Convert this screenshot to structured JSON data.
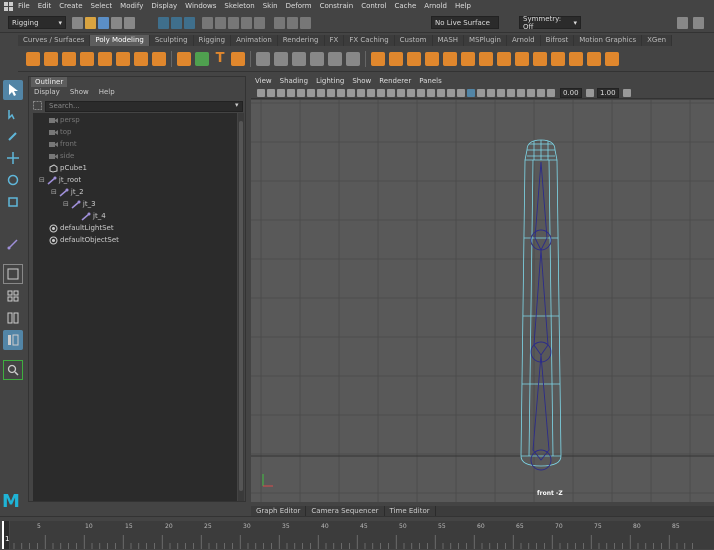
{
  "menubar": {
    "items": [
      "File",
      "Edit",
      "Create",
      "Select",
      "Modify",
      "Display",
      "Windows",
      "Skeleton",
      "Skin",
      "Deform",
      "Constrain",
      "Control",
      "Cache",
      "Arnold",
      "Help"
    ]
  },
  "statusline": {
    "menuset": "Rigging",
    "live_surface": "No Live Surface",
    "symmetry": "Symmetry: Off"
  },
  "shelf": {
    "tabs": [
      "Curves / Surfaces",
      "Poly Modeling",
      "Sculpting",
      "Rigging",
      "Animation",
      "Rendering",
      "FX",
      "FX Caching",
      "Custom",
      "MASH",
      "MSPlugin",
      "Arnold",
      "Bifrost",
      "Motion Graphics",
      "XGen"
    ],
    "active_tab": "Poly Modeling"
  },
  "outliner": {
    "title": "Outliner",
    "menu": [
      "Display",
      "Show",
      "Help"
    ],
    "search_placeholder": "Search...",
    "nodes": [
      {
        "label": "persp",
        "dim": true,
        "indent": 0,
        "icon": "camera-icon"
      },
      {
        "label": "top",
        "dim": true,
        "indent": 0,
        "icon": "camera-icon"
      },
      {
        "label": "front",
        "dim": true,
        "indent": 0,
        "icon": "camera-icon"
      },
      {
        "label": "side",
        "dim": true,
        "indent": 0,
        "icon": "camera-icon"
      },
      {
        "label": "pCube1",
        "dim": false,
        "indent": 0,
        "icon": "mesh-icon"
      },
      {
        "label": "jt_root",
        "dim": false,
        "indent": 0,
        "icon": "joint-icon"
      },
      {
        "label": "jt_2",
        "dim": false,
        "indent": 1,
        "icon": "joint-icon"
      },
      {
        "label": "jt_3",
        "dim": false,
        "indent": 2,
        "icon": "joint-icon"
      },
      {
        "label": "jt_4",
        "dim": false,
        "indent": 3,
        "icon": "joint-icon"
      },
      {
        "label": "defaultLightSet",
        "dim": false,
        "indent": 0,
        "icon": "set-icon"
      },
      {
        "label": "defaultObjectSet",
        "dim": false,
        "indent": 0,
        "icon": "set-icon"
      }
    ]
  },
  "viewport": {
    "menu": [
      "View",
      "Shading",
      "Lighting",
      "Show",
      "Renderer",
      "Panels"
    ],
    "field_a": "0.00",
    "field_b": "1.00",
    "camera": "front -Z"
  },
  "bottom_tabs": [
    "Graph Editor",
    "Camera Sequencer",
    "Time Editor"
  ],
  "timeline": {
    "current_frame": "1",
    "ticks": [
      "5",
      "10",
      "15",
      "20",
      "25",
      "30",
      "35",
      "40",
      "45",
      "50",
      "55",
      "60",
      "65",
      "70",
      "75",
      "80",
      "85"
    ]
  },
  "colors": {
    "accent": "#5285a6",
    "shelf_icon": "#e0872d",
    "wireframe": "#7fd9ea",
    "joint": "#2b2b8a"
  }
}
